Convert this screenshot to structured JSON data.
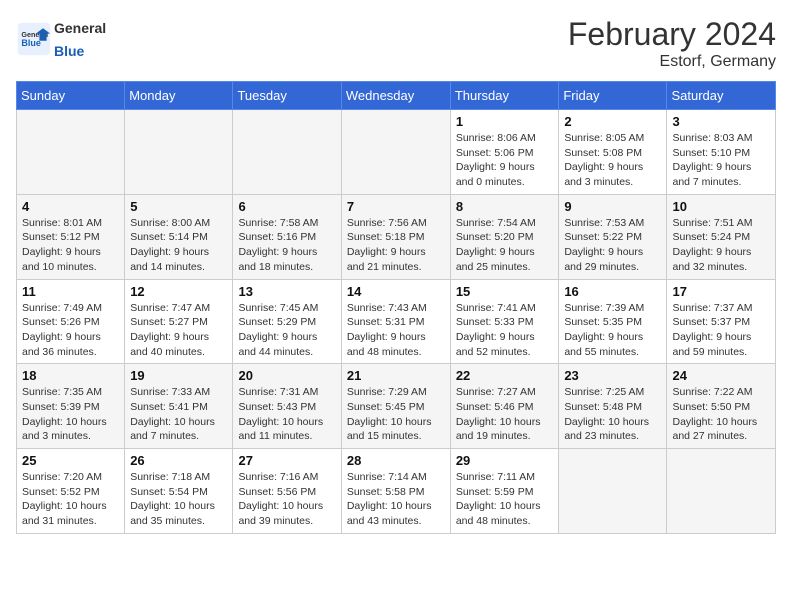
{
  "header": {
    "logo_text_general": "General",
    "logo_text_blue": "Blue",
    "month_title": "February 2024",
    "location": "Estorf, Germany"
  },
  "weekdays": [
    "Sunday",
    "Monday",
    "Tuesday",
    "Wednesday",
    "Thursday",
    "Friday",
    "Saturday"
  ],
  "weeks": [
    [
      {
        "day": "",
        "info": ""
      },
      {
        "day": "",
        "info": ""
      },
      {
        "day": "",
        "info": ""
      },
      {
        "day": "",
        "info": ""
      },
      {
        "day": "1",
        "info": "Sunrise: 8:06 AM\nSunset: 5:06 PM\nDaylight: 9 hours\nand 0 minutes."
      },
      {
        "day": "2",
        "info": "Sunrise: 8:05 AM\nSunset: 5:08 PM\nDaylight: 9 hours\nand 3 minutes."
      },
      {
        "day": "3",
        "info": "Sunrise: 8:03 AM\nSunset: 5:10 PM\nDaylight: 9 hours\nand 7 minutes."
      }
    ],
    [
      {
        "day": "4",
        "info": "Sunrise: 8:01 AM\nSunset: 5:12 PM\nDaylight: 9 hours\nand 10 minutes."
      },
      {
        "day": "5",
        "info": "Sunrise: 8:00 AM\nSunset: 5:14 PM\nDaylight: 9 hours\nand 14 minutes."
      },
      {
        "day": "6",
        "info": "Sunrise: 7:58 AM\nSunset: 5:16 PM\nDaylight: 9 hours\nand 18 minutes."
      },
      {
        "day": "7",
        "info": "Sunrise: 7:56 AM\nSunset: 5:18 PM\nDaylight: 9 hours\nand 21 minutes."
      },
      {
        "day": "8",
        "info": "Sunrise: 7:54 AM\nSunset: 5:20 PM\nDaylight: 9 hours\nand 25 minutes."
      },
      {
        "day": "9",
        "info": "Sunrise: 7:53 AM\nSunset: 5:22 PM\nDaylight: 9 hours\nand 29 minutes."
      },
      {
        "day": "10",
        "info": "Sunrise: 7:51 AM\nSunset: 5:24 PM\nDaylight: 9 hours\nand 32 minutes."
      }
    ],
    [
      {
        "day": "11",
        "info": "Sunrise: 7:49 AM\nSunset: 5:26 PM\nDaylight: 9 hours\nand 36 minutes."
      },
      {
        "day": "12",
        "info": "Sunrise: 7:47 AM\nSunset: 5:27 PM\nDaylight: 9 hours\nand 40 minutes."
      },
      {
        "day": "13",
        "info": "Sunrise: 7:45 AM\nSunset: 5:29 PM\nDaylight: 9 hours\nand 44 minutes."
      },
      {
        "day": "14",
        "info": "Sunrise: 7:43 AM\nSunset: 5:31 PM\nDaylight: 9 hours\nand 48 minutes."
      },
      {
        "day": "15",
        "info": "Sunrise: 7:41 AM\nSunset: 5:33 PM\nDaylight: 9 hours\nand 52 minutes."
      },
      {
        "day": "16",
        "info": "Sunrise: 7:39 AM\nSunset: 5:35 PM\nDaylight: 9 hours\nand 55 minutes."
      },
      {
        "day": "17",
        "info": "Sunrise: 7:37 AM\nSunset: 5:37 PM\nDaylight: 9 hours\nand 59 minutes."
      }
    ],
    [
      {
        "day": "18",
        "info": "Sunrise: 7:35 AM\nSunset: 5:39 PM\nDaylight: 10 hours\nand 3 minutes."
      },
      {
        "day": "19",
        "info": "Sunrise: 7:33 AM\nSunset: 5:41 PM\nDaylight: 10 hours\nand 7 minutes."
      },
      {
        "day": "20",
        "info": "Sunrise: 7:31 AM\nSunset: 5:43 PM\nDaylight: 10 hours\nand 11 minutes."
      },
      {
        "day": "21",
        "info": "Sunrise: 7:29 AM\nSunset: 5:45 PM\nDaylight: 10 hours\nand 15 minutes."
      },
      {
        "day": "22",
        "info": "Sunrise: 7:27 AM\nSunset: 5:46 PM\nDaylight: 10 hours\nand 19 minutes."
      },
      {
        "day": "23",
        "info": "Sunrise: 7:25 AM\nSunset: 5:48 PM\nDaylight: 10 hours\nand 23 minutes."
      },
      {
        "day": "24",
        "info": "Sunrise: 7:22 AM\nSunset: 5:50 PM\nDaylight: 10 hours\nand 27 minutes."
      }
    ],
    [
      {
        "day": "25",
        "info": "Sunrise: 7:20 AM\nSunset: 5:52 PM\nDaylight: 10 hours\nand 31 minutes."
      },
      {
        "day": "26",
        "info": "Sunrise: 7:18 AM\nSunset: 5:54 PM\nDaylight: 10 hours\nand 35 minutes."
      },
      {
        "day": "27",
        "info": "Sunrise: 7:16 AM\nSunset: 5:56 PM\nDaylight: 10 hours\nand 39 minutes."
      },
      {
        "day": "28",
        "info": "Sunrise: 7:14 AM\nSunset: 5:58 PM\nDaylight: 10 hours\nand 43 minutes."
      },
      {
        "day": "29",
        "info": "Sunrise: 7:11 AM\nSunset: 5:59 PM\nDaylight: 10 hours\nand 48 minutes."
      },
      {
        "day": "",
        "info": ""
      },
      {
        "day": "",
        "info": ""
      }
    ]
  ]
}
